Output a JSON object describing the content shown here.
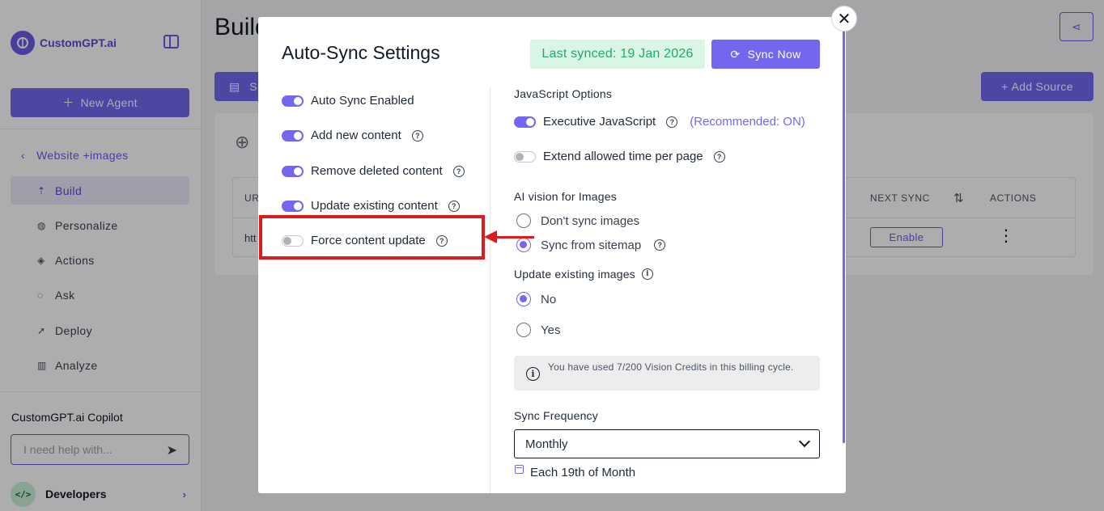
{
  "sidebar": {
    "logo_text": "CustomGPT.ai",
    "new_agent_label": "New Agent",
    "back_label": "Website +images",
    "nav": [
      {
        "label": "Build",
        "icon": "build-icon",
        "active": true
      },
      {
        "label": "Personalize",
        "icon": "palette-icon"
      },
      {
        "label": "Actions",
        "icon": "actions-icon"
      },
      {
        "label": "Ask",
        "icon": "chat-icon"
      },
      {
        "label": "Deploy",
        "icon": "rocket-icon"
      },
      {
        "label": "Analyze",
        "icon": "chart-icon"
      }
    ],
    "copilot_title": "CustomGPT.ai Copilot",
    "copilot_placeholder": "I need help with...",
    "developers_label": "Developers"
  },
  "main": {
    "title": "Build",
    "tab_label": "S",
    "add_source_label": "Add Source",
    "table": {
      "headers": {
        "url": "UR",
        "next_sync": "NEXT SYNC",
        "actions": "ACTIONS"
      },
      "row": {
        "url": "htt",
        "action_label": "Enable"
      }
    }
  },
  "modal": {
    "title": "Auto-Sync Settings",
    "last_synced": "Last synced: 19 Jan 2026",
    "sync_now_label": "Sync Now",
    "toggles": [
      {
        "label": "Auto Sync Enabled",
        "on": true,
        "help": false
      },
      {
        "label": "Add new content",
        "on": true,
        "help": true
      },
      {
        "label": "Remove deleted content",
        "on": true,
        "help": true
      },
      {
        "label": "Update existing content",
        "on": true,
        "help": true
      },
      {
        "label": "Force content update",
        "on": false,
        "help": true
      }
    ],
    "js_options": {
      "heading": "JavaScript Options",
      "executive_js_label": "Executive JavaScript",
      "recommended": "(Recommended: ON)",
      "extend_time_label": "Extend allowed time per page"
    },
    "ai_vision": {
      "heading": "AI vision for Images",
      "options": [
        "Don't sync images",
        "Sync from sitemap"
      ],
      "selected": "Sync from sitemap"
    },
    "update_images": {
      "heading": "Update existing images",
      "options": [
        "No",
        "Yes"
      ],
      "selected": "No"
    },
    "credits_text": "You have used 7/200 Vision Credits in this billing cycle.",
    "sync_frequency": {
      "heading": "Sync Frequency",
      "value": "Monthly",
      "schedule": "Each 19th of Month"
    }
  },
  "colors": {
    "accent": "#7367f0",
    "success": "#27a969",
    "annotation": "#dc1c1c"
  }
}
